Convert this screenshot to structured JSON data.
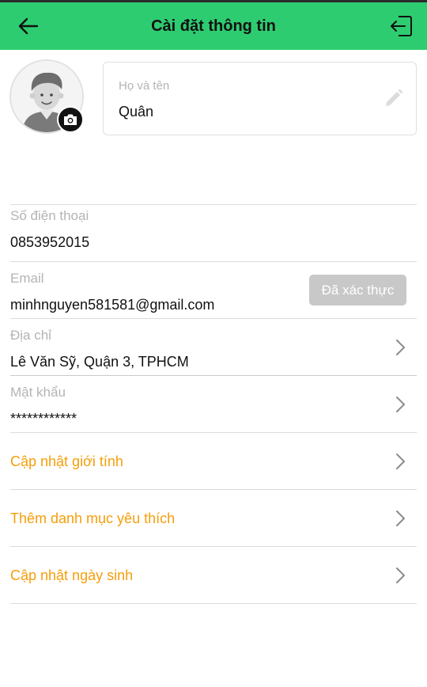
{
  "header": {
    "title": "Cài đặt thông tin",
    "back_icon": "arrow-left-icon",
    "logout_icon": "logout-icon",
    "background": "#2ecc71"
  },
  "profile": {
    "avatar_icon": "user-avatar-icon",
    "camera_icon": "camera-icon",
    "name_label": "Họ và tên",
    "name_value": "Quân",
    "edit_icon": "pencil-icon"
  },
  "fields": {
    "phone": {
      "label": "Số điện thoại",
      "value": "0853952015"
    },
    "email": {
      "label": "Email",
      "value": "minhnguyen581581@gmail.com",
      "status_button": "Đã xác thực"
    },
    "address": {
      "label": "Địa chỉ",
      "value": "Lê Văn Sỹ, Quận 3, TPHCM"
    },
    "password": {
      "label": "Mật khẩu",
      "value": "************"
    }
  },
  "actions": [
    {
      "label": "Cập nhật giới tính"
    },
    {
      "label": "Thêm danh mục yêu thích"
    },
    {
      "label": "Cập nhật ngày sinh"
    }
  ],
  "colors": {
    "accent": "#2ecc71",
    "action_text": "#f59e0b",
    "muted_label": "#b4b4b4",
    "verified_button": "#c8c8c8"
  }
}
